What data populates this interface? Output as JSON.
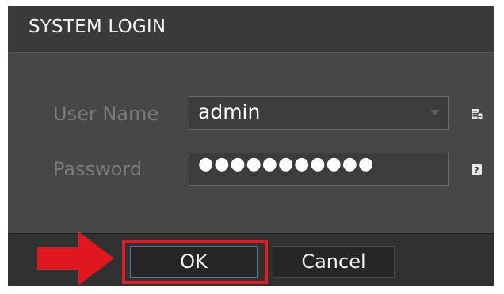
{
  "dialog": {
    "title": "SYSTEM LOGIN"
  },
  "form": {
    "username": {
      "label": "User Name",
      "value": "admin",
      "icon": "user-list-icon"
    },
    "password": {
      "label": "Password",
      "masked_value": "●●●●●●●●●●●",
      "icon": "help-icon"
    }
  },
  "buttons": {
    "ok_label": "OK",
    "cancel_label": "Cancel"
  },
  "annotation": {
    "arrow_color": "#e0171f",
    "highlight_color": "#d8202a"
  }
}
